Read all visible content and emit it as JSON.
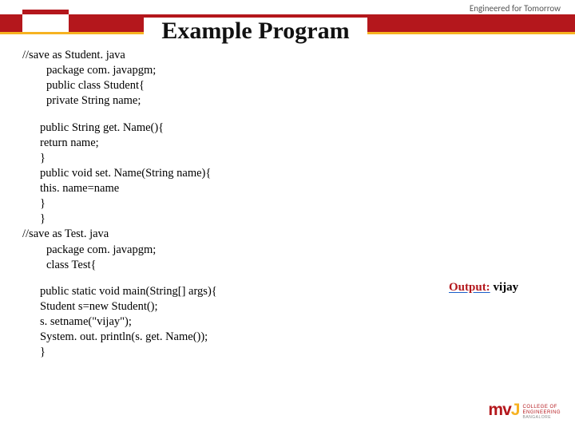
{
  "tagline": "Engineered for Tomorrow",
  "title": "Example Program",
  "code": {
    "l1": "//save as Student. java",
    "l2": "package com. javapgm;",
    "l3": "public class Student{",
    "l4": "private String name;",
    "l5": "public String get. Name(){",
    "l6": "return name;",
    "l7": "}",
    "l8": "public void set. Name(String name){",
    "l9": "this. name=name",
    "l10": "}",
    "l11": "}",
    "l12": "//save as Test. java",
    "l13": "package com. javapgm;",
    "l14": "class Test{",
    "l15": "public static void main(String[] args){",
    "l16": "Student s=new Student();",
    "l17": "s. setname(\"vijay\");",
    "l18": "System. out. println(s. get. Name());",
    "l19": "}"
  },
  "output": {
    "label": "Output:",
    "value": " vijay"
  },
  "logo": {
    "mark_m": "m",
    "mark_v": "v",
    "mark_j": "J",
    "line1": "COLLEGE OF",
    "line2": "ENGINEERING",
    "line3": "BANGALORE"
  }
}
